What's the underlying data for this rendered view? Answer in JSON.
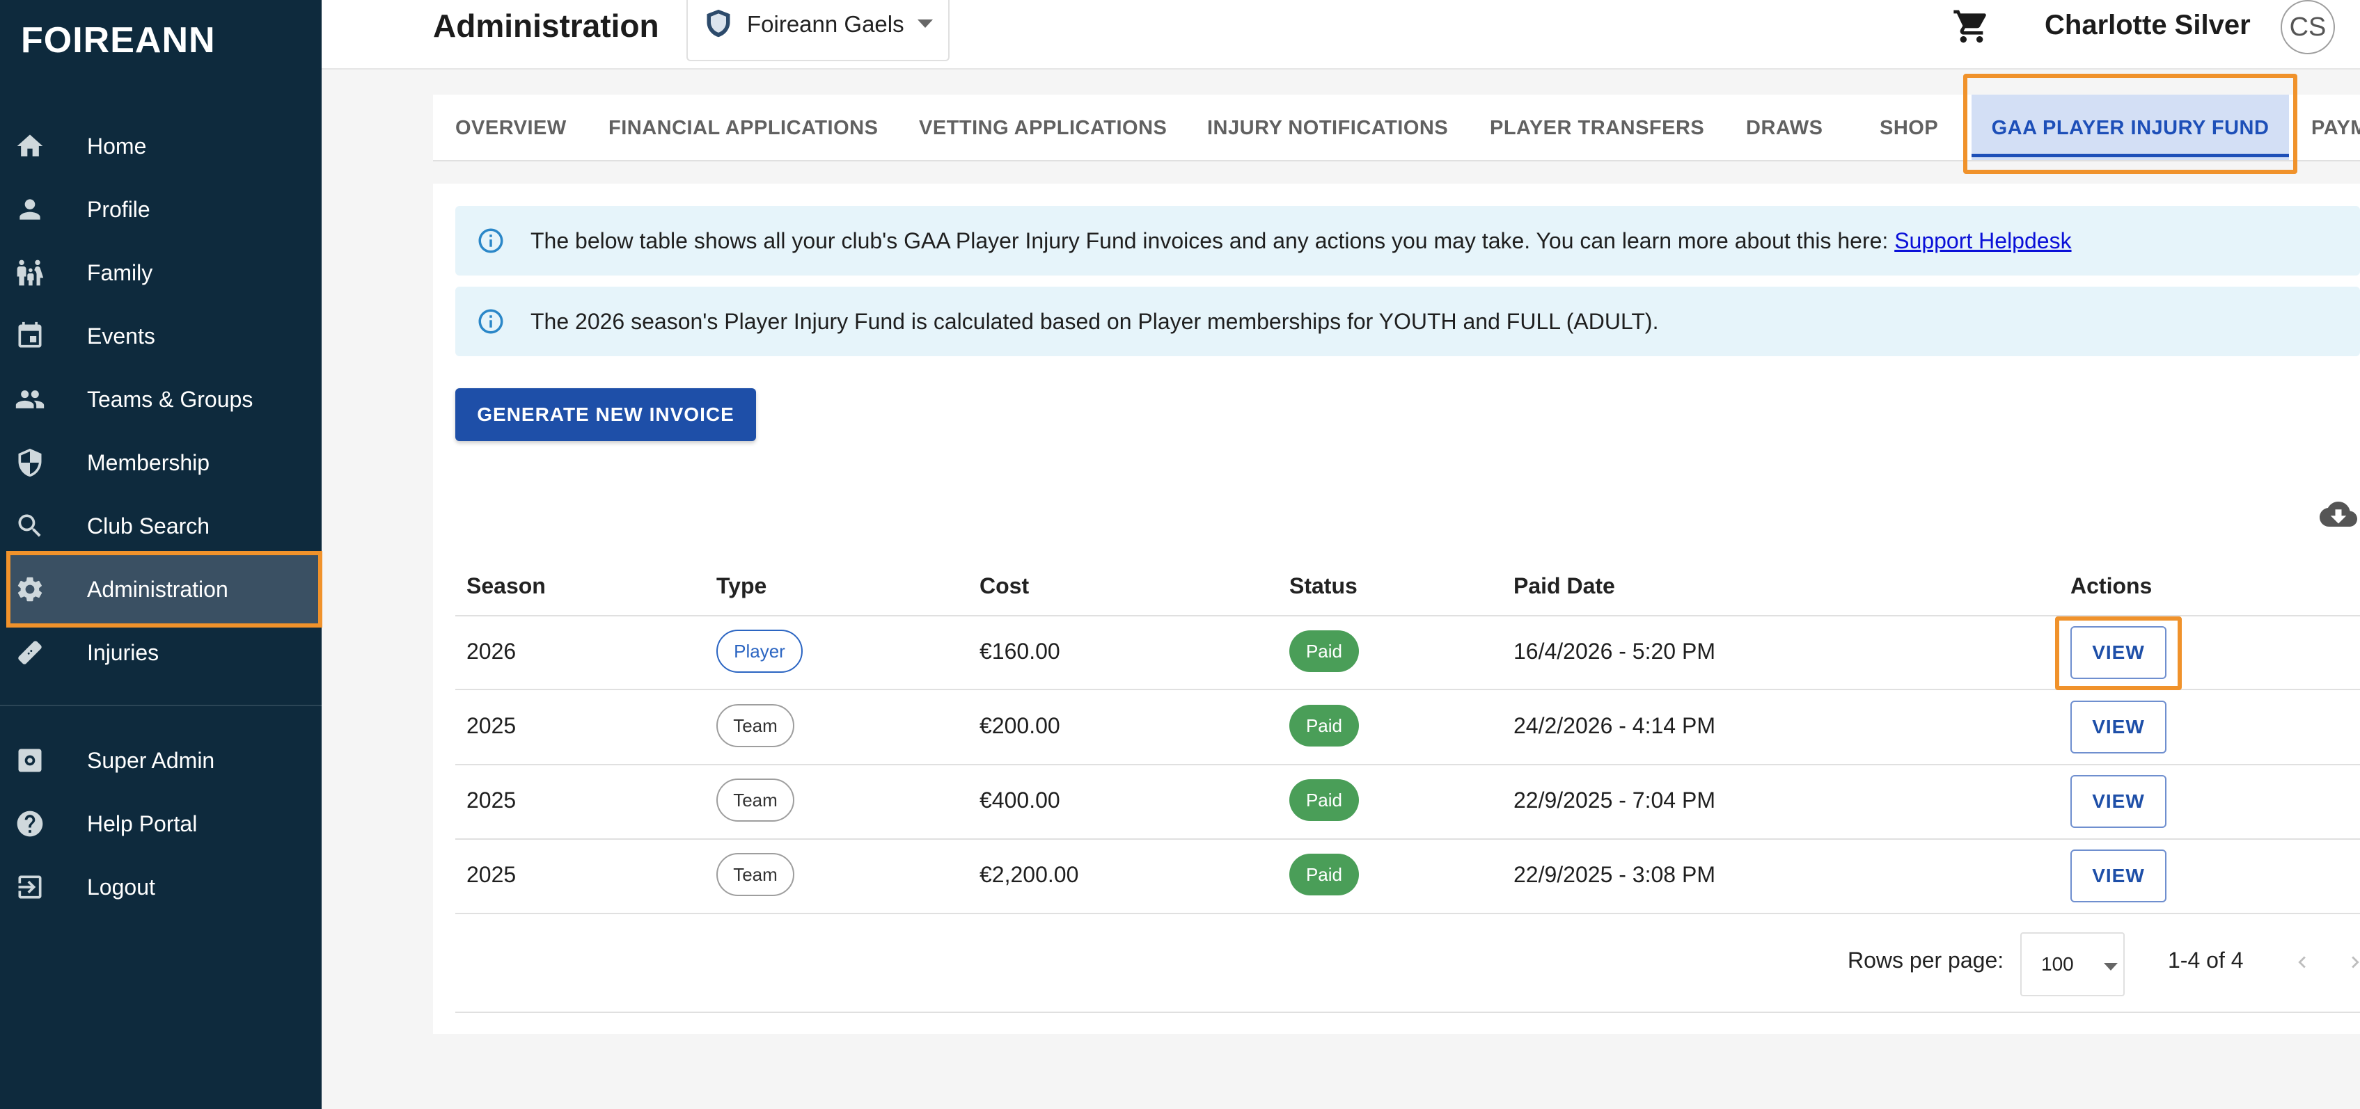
{
  "brand": {
    "logo": "FOIREANN"
  },
  "sidebar": {
    "items": [
      {
        "label": "Home",
        "icon": "home-icon"
      },
      {
        "label": "Profile",
        "icon": "person-icon"
      },
      {
        "label": "Family",
        "icon": "family-icon"
      },
      {
        "label": "Events",
        "icon": "calendar-icon"
      },
      {
        "label": "Teams & Groups",
        "icon": "group-icon"
      },
      {
        "label": "Membership",
        "icon": "shield-icon"
      },
      {
        "label": "Club Search",
        "icon": "search-icon"
      },
      {
        "label": "Administration",
        "icon": "gear-icon",
        "active": true
      },
      {
        "label": "Injuries",
        "icon": "bandage-icon"
      }
    ],
    "bottom_items": [
      {
        "label": "Super Admin",
        "icon": "admin-icon"
      },
      {
        "label": "Help Portal",
        "icon": "help-icon"
      },
      {
        "label": "Logout",
        "icon": "logout-icon"
      }
    ]
  },
  "header": {
    "title": "Administration",
    "club": "Foireann Gaels",
    "user_name": "Charlotte Silver",
    "avatar_initials": "CS"
  },
  "tabs": [
    {
      "label": "OVERVIEW"
    },
    {
      "label": "FINANCIAL APPLICATIONS"
    },
    {
      "label": "VETTING APPLICATIONS"
    },
    {
      "label": "INJURY NOTIFICATIONS"
    },
    {
      "label": "PLAYER TRANSFERS"
    },
    {
      "label": "DRAWS"
    },
    {
      "label": "SHOP"
    },
    {
      "label": "GAA PLAYER INJURY FUND",
      "active": true
    },
    {
      "label": "PAYM"
    }
  ],
  "alerts": {
    "first_text": "The below table shows all your club's GAA Player Injury Fund invoices and any actions you may take. You can learn more about this here: ",
    "first_link": "Support Helpdesk",
    "second_text": "The 2026 season's Player Injury Fund is calculated based on Player memberships for YOUTH and FULL (ADULT)."
  },
  "actions": {
    "generate_label": "GENERATE NEW INVOICE"
  },
  "table": {
    "headers": {
      "season": "Season",
      "type": "Type",
      "cost": "Cost",
      "status": "Status",
      "paid_date": "Paid Date",
      "actions": "Actions"
    },
    "view_label": "VIEW",
    "rows": [
      {
        "season": "2026",
        "type": "Player",
        "cost": "€160.00",
        "status": "Paid",
        "paid_date": "16/4/2026 - 5:20 PM"
      },
      {
        "season": "2025",
        "type": "Team",
        "cost": "€200.00",
        "status": "Paid",
        "paid_date": "24/2/2026 - 4:14 PM"
      },
      {
        "season": "2025",
        "type": "Team",
        "cost": "€400.00",
        "status": "Paid",
        "paid_date": "22/9/2025 - 7:04 PM"
      },
      {
        "season": "2025",
        "type": "Team",
        "cost": "€2,200.00",
        "status": "Paid",
        "paid_date": "22/9/2025 - 3:08 PM"
      }
    ]
  },
  "pagination": {
    "rows_per_page_label": "Rows per page:",
    "rows_per_page": "100",
    "range": "1-4 of 4"
  },
  "colors": {
    "sidebar_bg": "#0e2a3d",
    "primary": "#1e4fa8",
    "highlight": "#f0922b",
    "paid": "#4a9e58"
  }
}
